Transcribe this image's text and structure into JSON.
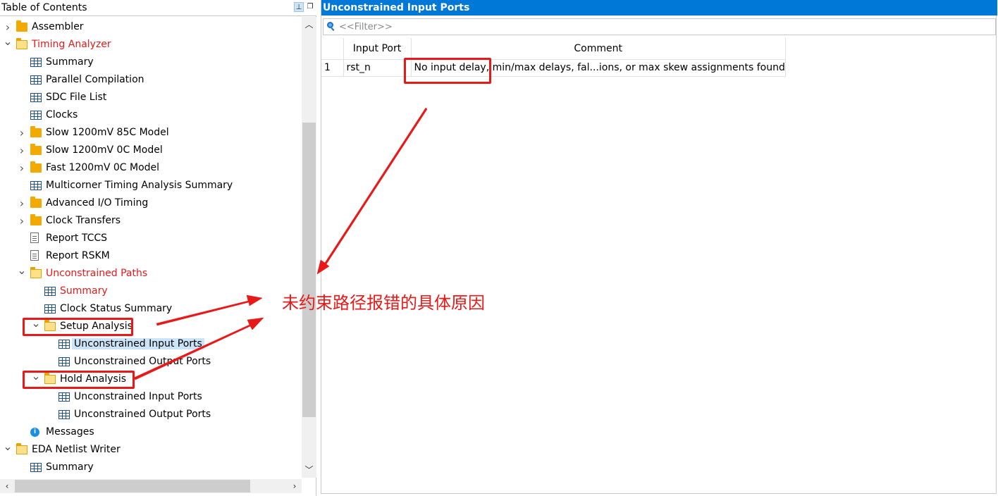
{
  "toc": {
    "title": "Table of Contents",
    "items": [
      {
        "label": "Assembler",
        "icon": "folder-icon",
        "expander": "collapsed",
        "red": false
      },
      {
        "label": "Timing Analyzer",
        "icon": "folder-open-icon",
        "expander": "expanded",
        "red": true
      },
      {
        "label": "Summary",
        "icon": "table-icon",
        "expander": "none",
        "red": false
      },
      {
        "label": "Parallel Compilation",
        "icon": "table-icon",
        "expander": "none",
        "red": false
      },
      {
        "label": "SDC File List",
        "icon": "table-icon",
        "expander": "none",
        "red": false
      },
      {
        "label": "Clocks",
        "icon": "table-icon",
        "expander": "none",
        "red": false
      },
      {
        "label": "Slow 1200mV 85C Model",
        "icon": "folder-icon",
        "expander": "collapsed",
        "red": false
      },
      {
        "label": "Slow 1200mV 0C Model",
        "icon": "folder-icon",
        "expander": "collapsed",
        "red": false
      },
      {
        "label": "Fast 1200mV 0C Model",
        "icon": "folder-icon",
        "expander": "collapsed",
        "red": false
      },
      {
        "label": "Multicorner Timing Analysis Summary",
        "icon": "table-icon",
        "expander": "none",
        "red": false
      },
      {
        "label": "Advanced I/O Timing",
        "icon": "folder-icon",
        "expander": "collapsed",
        "red": false
      },
      {
        "label": "Clock Transfers",
        "icon": "folder-icon",
        "expander": "collapsed",
        "red": false
      },
      {
        "label": "Report TCCS",
        "icon": "document-icon",
        "expander": "none",
        "red": false
      },
      {
        "label": "Report RSKM",
        "icon": "document-icon",
        "expander": "none",
        "red": false
      },
      {
        "label": "Unconstrained Paths",
        "icon": "folder-open-icon",
        "expander": "expanded",
        "red": true
      },
      {
        "label": "Summary",
        "icon": "table-icon",
        "expander": "none",
        "red": true
      },
      {
        "label": "Clock Status Summary",
        "icon": "table-icon",
        "expander": "none",
        "red": false
      },
      {
        "label": "Setup Analysis",
        "icon": "folder-open-icon",
        "expander": "expanded",
        "red": false
      },
      {
        "label": "Unconstrained Input Ports",
        "icon": "table-icon",
        "expander": "none",
        "red": false,
        "selected": true
      },
      {
        "label": "Unconstrained Output Ports",
        "icon": "table-icon",
        "expander": "none",
        "red": false
      },
      {
        "label": "Hold Analysis",
        "icon": "folder-open-icon",
        "expander": "expanded",
        "red": false
      },
      {
        "label": "Unconstrained Input Ports",
        "icon": "table-icon",
        "expander": "none",
        "red": false
      },
      {
        "label": "Unconstrained Output Ports",
        "icon": "table-icon",
        "expander": "none",
        "red": false
      },
      {
        "label": "Messages",
        "icon": "info-icon",
        "expander": "none",
        "red": false
      },
      {
        "label": "EDA Netlist Writer",
        "icon": "folder-open-icon",
        "expander": "expanded",
        "red": false
      },
      {
        "label": "Summary",
        "icon": "table-icon",
        "expander": "none",
        "red": false
      }
    ]
  },
  "report": {
    "title": "Unconstrained Input Ports",
    "filter_placeholder": "<<Filter>>",
    "columns": [
      "",
      "Input Port",
      "Comment"
    ],
    "rows": [
      {
        "index": "1",
        "port": "rst_n",
        "comment": "No input delay, min/max delays, fal...ions, or max skew assignments found"
      }
    ]
  },
  "annotation": {
    "text": "未约束路径报错的具体原因"
  },
  "colors": {
    "accent": "#0078d7",
    "annotation_red": "#e81919",
    "selection": "#cce4f7",
    "folder": "#f2a900"
  }
}
